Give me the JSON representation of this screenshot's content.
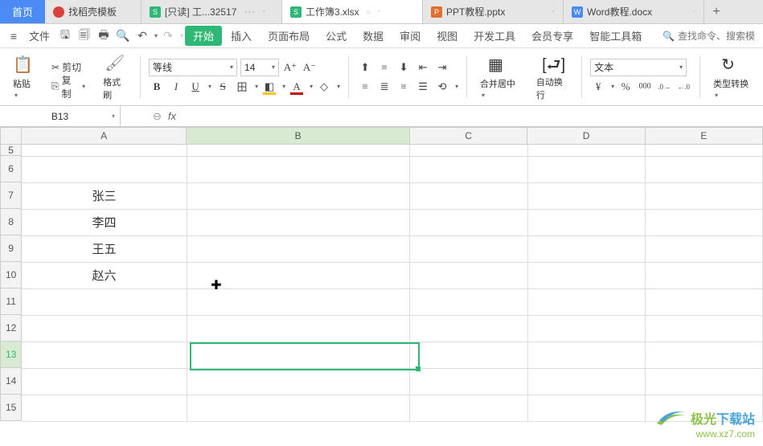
{
  "tabs": {
    "home": "首页",
    "items": [
      {
        "label": "找稻壳模板",
        "color": "#d8423a",
        "active": false
      },
      {
        "label": "[只读] 工...32517",
        "color": "#2fb875",
        "active": false
      },
      {
        "label": "工作簿3.xlsx",
        "color": "#2fb875",
        "active": true
      },
      {
        "label": "PPT教程.pptx",
        "color": "#e07030",
        "active": false
      },
      {
        "label": "Word教程.docx",
        "color": "#4a8bf5",
        "active": false
      }
    ]
  },
  "menu": {
    "file": "文件",
    "start": "开始",
    "tabs": [
      "插入",
      "页面布局",
      "公式",
      "数据",
      "审阅",
      "视图",
      "开发工具",
      "会员专享",
      "智能工具箱"
    ],
    "search_placeholder": "查找命令、搜索模"
  },
  "ribbon": {
    "paste": "粘贴",
    "cut": "剪切",
    "copy": "复制",
    "format_painter": "格式刷",
    "font_name": "等线",
    "font_size": "14",
    "merge_center": "合并居中",
    "auto_wrap": "自动换行",
    "number_format": "文本",
    "type_convert": "类型转换"
  },
  "namebox": "B13",
  "columns": [
    "A",
    "B",
    "C",
    "D",
    "E"
  ],
  "rows": [
    "5",
    "6",
    "7",
    "8",
    "9",
    "10",
    "11",
    "12",
    "13",
    "14",
    "15"
  ],
  "cells": {
    "A7": "张三",
    "A8": "李四",
    "A9": "王五",
    "A10": "赵六"
  },
  "watermark": {
    "brand_prefix": "极光",
    "brand_suffix": "下载站",
    "url": "www.xz7.com"
  }
}
